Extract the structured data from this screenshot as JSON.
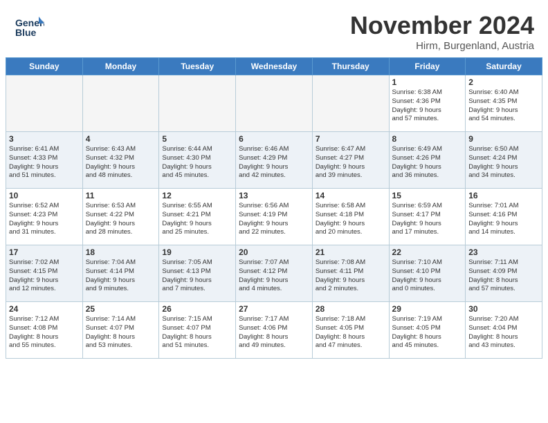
{
  "header": {
    "logo_line1": "General",
    "logo_line2": "Blue",
    "month_title": "November 2024",
    "location": "Hirm, Burgenland, Austria"
  },
  "days_of_week": [
    "Sunday",
    "Monday",
    "Tuesday",
    "Wednesday",
    "Thursday",
    "Friday",
    "Saturday"
  ],
  "weeks": [
    [
      {
        "day": "",
        "info": "",
        "empty": true
      },
      {
        "day": "",
        "info": "",
        "empty": true
      },
      {
        "day": "",
        "info": "",
        "empty": true
      },
      {
        "day": "",
        "info": "",
        "empty": true
      },
      {
        "day": "",
        "info": "",
        "empty": true
      },
      {
        "day": "1",
        "info": "Sunrise: 6:38 AM\nSunset: 4:36 PM\nDaylight: 9 hours\nand 57 minutes."
      },
      {
        "day": "2",
        "info": "Sunrise: 6:40 AM\nSunset: 4:35 PM\nDaylight: 9 hours\nand 54 minutes."
      }
    ],
    [
      {
        "day": "3",
        "info": "Sunrise: 6:41 AM\nSunset: 4:33 PM\nDaylight: 9 hours\nand 51 minutes."
      },
      {
        "day": "4",
        "info": "Sunrise: 6:43 AM\nSunset: 4:32 PM\nDaylight: 9 hours\nand 48 minutes."
      },
      {
        "day": "5",
        "info": "Sunrise: 6:44 AM\nSunset: 4:30 PM\nDaylight: 9 hours\nand 45 minutes."
      },
      {
        "day": "6",
        "info": "Sunrise: 6:46 AM\nSunset: 4:29 PM\nDaylight: 9 hours\nand 42 minutes."
      },
      {
        "day": "7",
        "info": "Sunrise: 6:47 AM\nSunset: 4:27 PM\nDaylight: 9 hours\nand 39 minutes."
      },
      {
        "day": "8",
        "info": "Sunrise: 6:49 AM\nSunset: 4:26 PM\nDaylight: 9 hours\nand 36 minutes."
      },
      {
        "day": "9",
        "info": "Sunrise: 6:50 AM\nSunset: 4:24 PM\nDaylight: 9 hours\nand 34 minutes."
      }
    ],
    [
      {
        "day": "10",
        "info": "Sunrise: 6:52 AM\nSunset: 4:23 PM\nDaylight: 9 hours\nand 31 minutes."
      },
      {
        "day": "11",
        "info": "Sunrise: 6:53 AM\nSunset: 4:22 PM\nDaylight: 9 hours\nand 28 minutes."
      },
      {
        "day": "12",
        "info": "Sunrise: 6:55 AM\nSunset: 4:21 PM\nDaylight: 9 hours\nand 25 minutes."
      },
      {
        "day": "13",
        "info": "Sunrise: 6:56 AM\nSunset: 4:19 PM\nDaylight: 9 hours\nand 22 minutes."
      },
      {
        "day": "14",
        "info": "Sunrise: 6:58 AM\nSunset: 4:18 PM\nDaylight: 9 hours\nand 20 minutes."
      },
      {
        "day": "15",
        "info": "Sunrise: 6:59 AM\nSunset: 4:17 PM\nDaylight: 9 hours\nand 17 minutes."
      },
      {
        "day": "16",
        "info": "Sunrise: 7:01 AM\nSunset: 4:16 PM\nDaylight: 9 hours\nand 14 minutes."
      }
    ],
    [
      {
        "day": "17",
        "info": "Sunrise: 7:02 AM\nSunset: 4:15 PM\nDaylight: 9 hours\nand 12 minutes."
      },
      {
        "day": "18",
        "info": "Sunrise: 7:04 AM\nSunset: 4:14 PM\nDaylight: 9 hours\nand 9 minutes."
      },
      {
        "day": "19",
        "info": "Sunrise: 7:05 AM\nSunset: 4:13 PM\nDaylight: 9 hours\nand 7 minutes."
      },
      {
        "day": "20",
        "info": "Sunrise: 7:07 AM\nSunset: 4:12 PM\nDaylight: 9 hours\nand 4 minutes."
      },
      {
        "day": "21",
        "info": "Sunrise: 7:08 AM\nSunset: 4:11 PM\nDaylight: 9 hours\nand 2 minutes."
      },
      {
        "day": "22",
        "info": "Sunrise: 7:10 AM\nSunset: 4:10 PM\nDaylight: 9 hours\nand 0 minutes."
      },
      {
        "day": "23",
        "info": "Sunrise: 7:11 AM\nSunset: 4:09 PM\nDaylight: 8 hours\nand 57 minutes."
      }
    ],
    [
      {
        "day": "24",
        "info": "Sunrise: 7:12 AM\nSunset: 4:08 PM\nDaylight: 8 hours\nand 55 minutes."
      },
      {
        "day": "25",
        "info": "Sunrise: 7:14 AM\nSunset: 4:07 PM\nDaylight: 8 hours\nand 53 minutes."
      },
      {
        "day": "26",
        "info": "Sunrise: 7:15 AM\nSunset: 4:07 PM\nDaylight: 8 hours\nand 51 minutes."
      },
      {
        "day": "27",
        "info": "Sunrise: 7:17 AM\nSunset: 4:06 PM\nDaylight: 8 hours\nand 49 minutes."
      },
      {
        "day": "28",
        "info": "Sunrise: 7:18 AM\nSunset: 4:05 PM\nDaylight: 8 hours\nand 47 minutes."
      },
      {
        "day": "29",
        "info": "Sunrise: 7:19 AM\nSunset: 4:05 PM\nDaylight: 8 hours\nand 45 minutes."
      },
      {
        "day": "30",
        "info": "Sunrise: 7:20 AM\nSunset: 4:04 PM\nDaylight: 8 hours\nand 43 minutes."
      }
    ]
  ]
}
